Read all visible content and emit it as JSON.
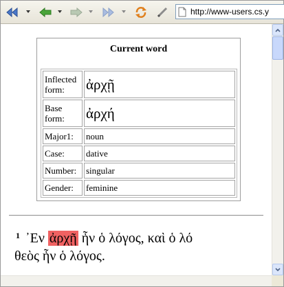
{
  "toolbar": {
    "back_icon": "rewind-icon",
    "url": "http://www-users.cs.y"
  },
  "current_word": {
    "title": "Current word",
    "rows": [
      {
        "label": "Inflected form:",
        "value": "ἀρχῇ"
      },
      {
        "label": "Base form:",
        "value": "ἀρχή"
      },
      {
        "label": "Major1:",
        "value": "noun"
      },
      {
        "label": "Case:",
        "value": "dative"
      },
      {
        "label": "Number:",
        "value": "singular"
      },
      {
        "label": "Gender:",
        "value": "feminine"
      }
    ]
  },
  "verse": {
    "number": "1",
    "before": "᾿Εν",
    "highlight": "ἀρχῇ",
    "after": "ἦν ὁ λόγος, καὶ ὁ λό",
    "line2": "θεὸς ἦν ὁ λόγος."
  },
  "colors": {
    "highlight": "#f06262",
    "toolbar_bg": "#ece9d8",
    "scrollbar_accent": "#c8d8fb"
  }
}
